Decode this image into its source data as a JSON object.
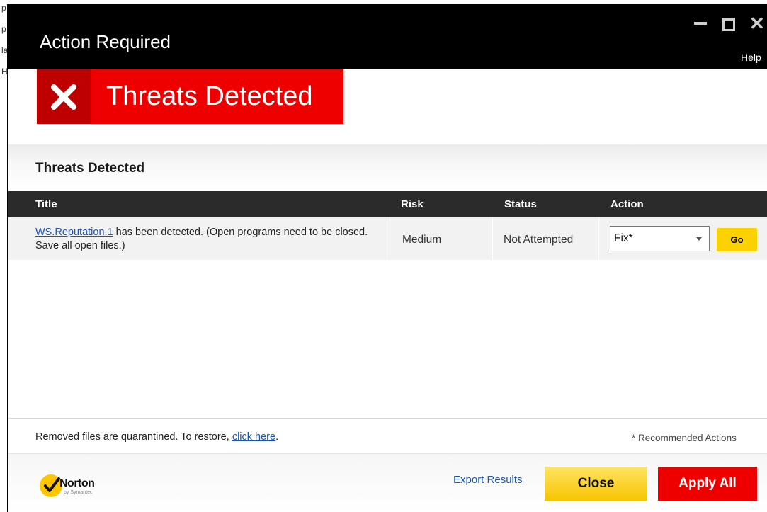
{
  "background": {
    "letters": [
      "p",
      "p",
      "la",
      "H"
    ]
  },
  "window": {
    "title": "Action Required",
    "help_label": "Help",
    "controls": [
      "minimize-icon",
      "maximize-icon",
      "close-icon"
    ]
  },
  "banner": {
    "icon": "x-icon",
    "title": "Threats Detected",
    "color": "#ee0000"
  },
  "section": {
    "title": "Threats Detected"
  },
  "table": {
    "columns": [
      "Title",
      "Risk",
      "Status",
      "Action"
    ],
    "rows": [
      {
        "threat_link": "WS.Reputation.1",
        "description": " has been detected. (Open programs need to be closed. Save all open files.)",
        "risk": "Medium",
        "status": "Not Attempted",
        "action_selected": "Fix*",
        "go_label": "Go"
      }
    ]
  },
  "footer": {
    "note_prefix": "Removed files are quarantined. To restore, ",
    "note_link": "click here",
    "note_suffix": ".",
    "recommended": "* Recommended Actions"
  },
  "bottom": {
    "logo_text": "Norton",
    "logo_sub": "by Symantec",
    "export_label": "Export Results",
    "close_label": "Close",
    "apply_all_label": "Apply All",
    "colors": {
      "close": "#fcd100",
      "apply_all": "#ee0000"
    }
  }
}
